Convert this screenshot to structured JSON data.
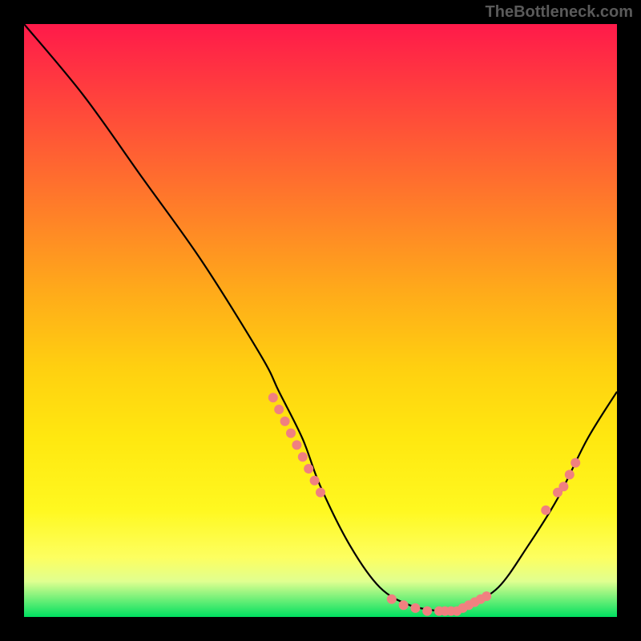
{
  "watermark": "TheBottleneck.com",
  "chart_data": {
    "type": "line",
    "title": "",
    "xlabel": "",
    "ylabel": "",
    "xlim": [
      0,
      100
    ],
    "ylim": [
      0,
      100
    ],
    "curve": {
      "x": [
        0,
        10,
        20,
        30,
        40,
        43,
        47,
        50,
        55,
        60,
        65,
        70,
        72,
        75,
        80,
        85,
        90,
        95,
        100
      ],
      "y": [
        100,
        88,
        74,
        60,
        44,
        38,
        30,
        22,
        12,
        5,
        2,
        1,
        1,
        2,
        5,
        12,
        20,
        30,
        38
      ]
    },
    "points": {
      "x": [
        42,
        43,
        44,
        45,
        46,
        47,
        48,
        49,
        50,
        62,
        64,
        66,
        68,
        70,
        71,
        72,
        73,
        74,
        75,
        76,
        77,
        78,
        88,
        90,
        91,
        92,
        93
      ],
      "y": [
        37,
        35,
        33,
        31,
        29,
        27,
        25,
        23,
        21,
        3,
        2,
        1.5,
        1,
        1,
        1,
        1,
        1,
        1.5,
        2,
        2.5,
        3,
        3.5,
        18,
        21,
        22,
        24,
        26
      ]
    },
    "point_color": "#f08080"
  }
}
